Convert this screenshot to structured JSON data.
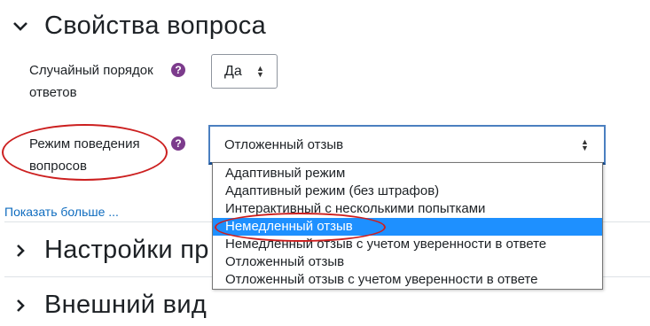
{
  "sections": {
    "question_properties": "Свойства вопроса",
    "settings_truncated": "Настройки пр",
    "appearance": "Внешний вид"
  },
  "fields": {
    "shuffle_label": "Случайный порядок ответов",
    "shuffle_value": "Да",
    "behaviour_label": "Режим поведения вопросов",
    "behaviour_value": "Отложенный отзыв",
    "help_glyph": "?"
  },
  "show_more": "Показать больше ...",
  "dropdown": {
    "options": [
      "Адаптивный режим",
      "Адаптивный режим (без штрафов)",
      "Интерактивный с несколькими попытками",
      "Немедленный отзыв",
      "Немедленный отзыв с учетом уверенности в ответе",
      "Отложенный отзыв",
      "Отложенный отзыв с учетом уверенности в ответе"
    ],
    "highlighted_index": 3
  },
  "icons": {
    "chevron_down": "chevron-down-icon",
    "chevron_right": "chevron-right-icon",
    "help": "help-icon",
    "select_arrows": "up-down-arrows-icon"
  },
  "colors": {
    "help_badge": "#7c3b8c",
    "link": "#0f6cbf",
    "highlight": "#1e90ff",
    "annotation_oval": "#cc1f1f"
  }
}
